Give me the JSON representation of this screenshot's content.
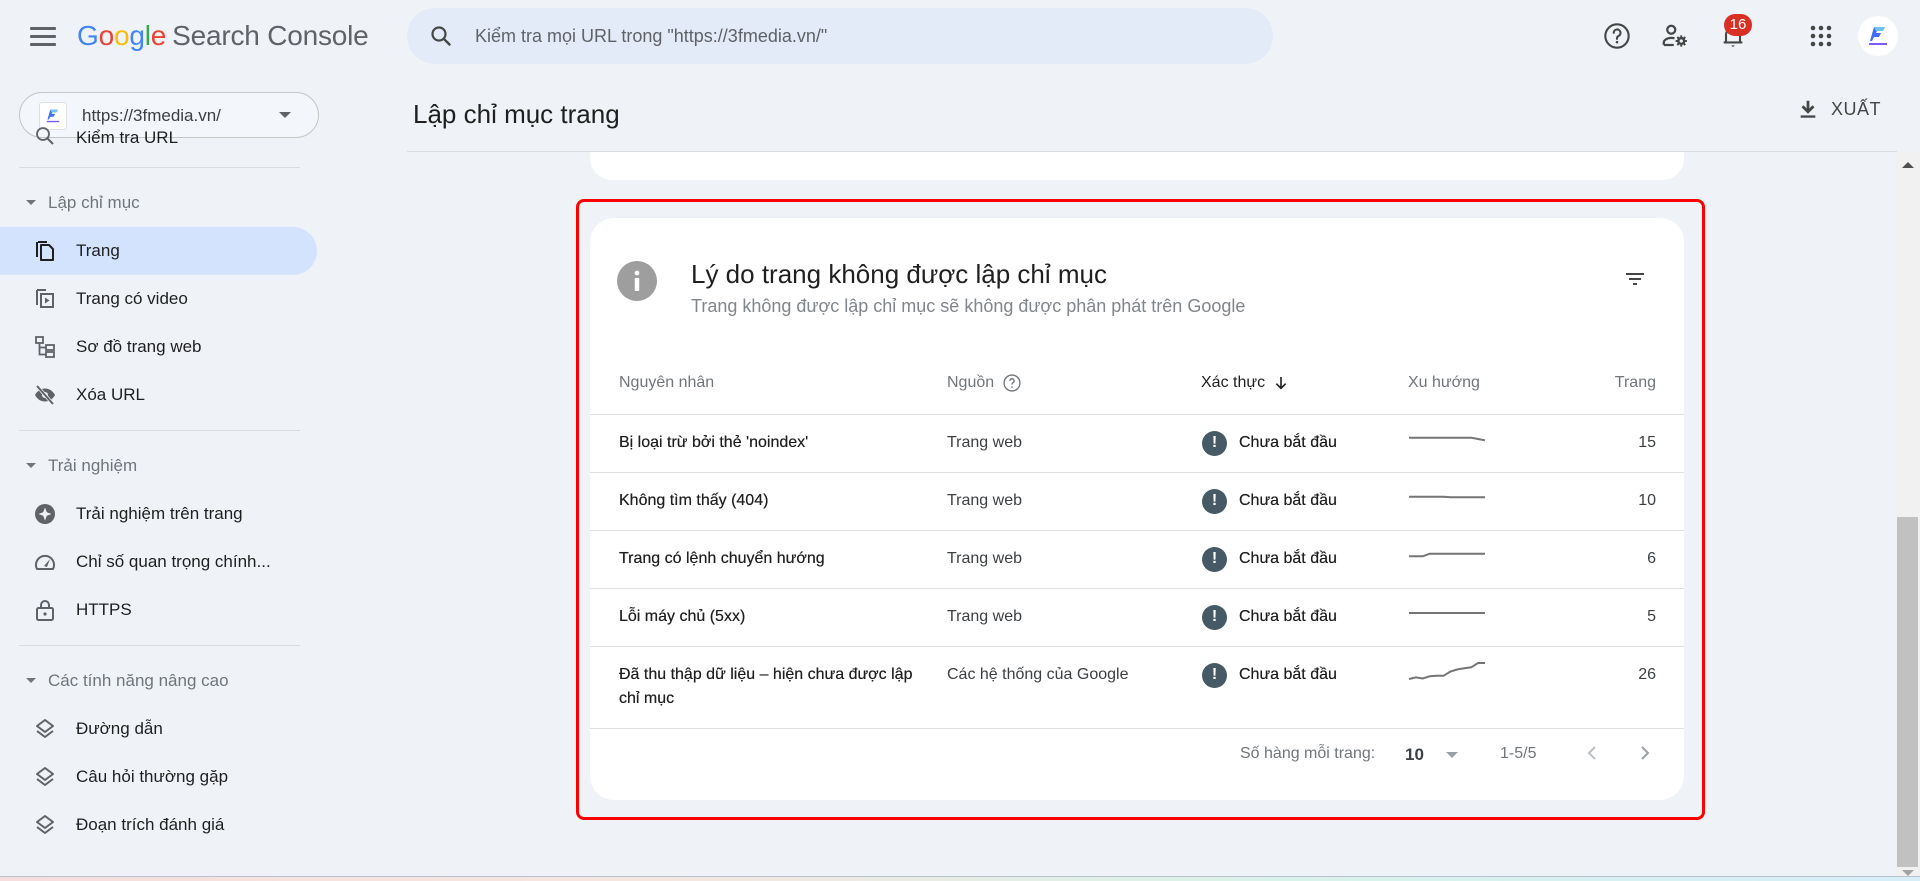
{
  "app": {
    "logo_letters": [
      "G",
      "o",
      "o",
      "g",
      "l",
      "e"
    ],
    "product_name": "Search Console"
  },
  "header": {
    "search_placeholder": "Kiểm tra mọi URL trong \"https://3fmedia.vn/\"",
    "notification_count": "16",
    "icons": [
      "help-icon",
      "admin-settings-icon",
      "notifications-bell-icon",
      "apps-grid-icon",
      "account-avatar"
    ]
  },
  "property": {
    "url": "https://3fmedia.vn/"
  },
  "sidebar": {
    "partial_item": "Kiểm tra URL",
    "groups": [
      {
        "label": "Lập chỉ mục",
        "items": [
          {
            "label": "Trang",
            "icon": "pages-icon",
            "active": true
          },
          {
            "label": "Trang có video",
            "icon": "video-pages-icon",
            "active": false
          },
          {
            "label": "Sơ đồ trang web",
            "icon": "sitemap-icon",
            "active": false
          },
          {
            "label": "Xóa URL",
            "icon": "removals-icon",
            "active": false
          }
        ]
      },
      {
        "label": "Trải nghiệm",
        "items": [
          {
            "label": "Trải nghiệm trên trang",
            "icon": "page-experience-icon"
          },
          {
            "label": "Chỉ số quan trọng chính...",
            "icon": "core-web-vitals-icon"
          },
          {
            "label": "HTTPS",
            "icon": "lock-icon"
          }
        ]
      },
      {
        "label": "Các tính năng nâng cao",
        "items": [
          {
            "label": "Đường dẫn",
            "icon": "layers-icon"
          },
          {
            "label": "Câu hỏi thường gặp",
            "icon": "layers-icon"
          },
          {
            "label": "Đoạn trích đánh giá",
            "icon": "layers-icon"
          }
        ]
      }
    ]
  },
  "main": {
    "page_title": "Lập chỉ mục trang",
    "export_label": "XUẤT"
  },
  "card": {
    "title": "Lý do trang không được lập chỉ mục",
    "subtitle": "Trang không được lập chỉ mục sẽ không được phân phát trên Google",
    "columns": {
      "reason": "Nguyên nhân",
      "source": "Nguồn",
      "validation": "Xác thực",
      "trend": "Xu hướng",
      "pages": "Trang"
    },
    "rows": [
      {
        "reason": "Bị loại trừ bởi thẻ 'noindex'",
        "source": "Trang web",
        "validation": "Chưa bắt đầu",
        "trend": [
          15,
          15,
          15,
          15,
          15,
          15,
          15,
          15,
          15,
          15,
          14.5,
          14
        ],
        "pages": "15"
      },
      {
        "reason": "Không tìm thấy (404)",
        "source": "Trang web",
        "validation": "Chưa bắt đầu",
        "trend": [
          10,
          10,
          10,
          10,
          10,
          10,
          9.8,
          9.8,
          9.8,
          9.8,
          9.8,
          9.8
        ],
        "pages": "10"
      },
      {
        "reason": "Trang có lệnh chuyển hướng",
        "source": "Trang web",
        "validation": "Chưa bắt đầu",
        "trend": [
          5,
          5,
          5,
          6,
          6,
          6,
          6,
          6,
          6,
          6,
          6,
          6
        ],
        "pages": "6"
      },
      {
        "reason": "Lỗi máy chủ (5xx)",
        "source": "Trang web",
        "validation": "Chưa bắt đầu",
        "trend": [
          5,
          5,
          5,
          5,
          5,
          5,
          5,
          5,
          5,
          5,
          5,
          5
        ],
        "pages": "5"
      },
      {
        "reason": "Đã thu thập dữ liệu – hiện chưa được lập chỉ mục",
        "source": "Các hệ thống của Google",
        "validation": "Chưa bắt đầu",
        "trend": [
          22,
          22.3,
          22.1,
          22.5,
          22.6,
          22.6,
          23.4,
          23.8,
          24,
          24.2,
          25,
          25
        ],
        "pages": "26"
      }
    ],
    "footer": {
      "rows_per_page_label": "Số hàng mỗi trang:",
      "rows_per_page_value": "10",
      "range": "1-5/5"
    }
  }
}
